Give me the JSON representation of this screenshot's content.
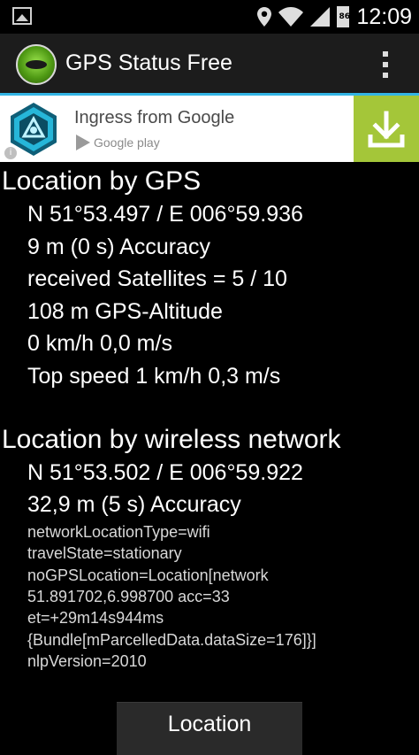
{
  "status_bar": {
    "time": "12:09",
    "battery_level": "86",
    "icons": [
      "picture-icon",
      "location-pin-icon",
      "wifi-icon",
      "signal-icon",
      "battery-icon"
    ]
  },
  "action_bar": {
    "title": "GPS Status Free",
    "accent_color": "#33b5e5"
  },
  "ad": {
    "title": "Ingress from Google",
    "store_label": "Google play",
    "info_label": "i",
    "download_color": "#a4c639"
  },
  "gps": {
    "heading": "Location by GPS",
    "coordinates": "N 51°53.497 / E 006°59.936",
    "accuracy": "9 m (0 s) Accuracy",
    "satellites": "received Satellites = 5 / 10",
    "altitude": "108 m GPS-Altitude",
    "speed": "0 km/h 0,0 m/s",
    "top_speed": "Top speed 1 km/h 0,3 m/s"
  },
  "network": {
    "heading": "Location by wireless network",
    "coordinates": "N 51°53.502 / E 006°59.922",
    "accuracy": "32,9 m (5 s) Accuracy",
    "details": [
      "networkLocationType=wifi",
      "travelState=stationary",
      "noGPSLocation=Location[network",
      "51.891702,6.998700 acc=33",
      "et=+29m14s944ms",
      "{Bundle[mParcelledData.dataSize=176]}]",
      "nlpVersion=2010"
    ]
  },
  "button": {
    "label": "Location"
  }
}
